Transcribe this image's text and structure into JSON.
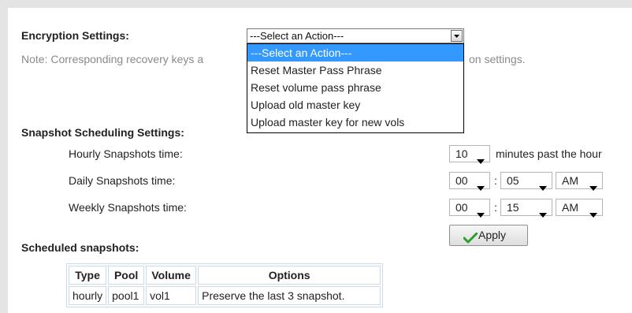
{
  "encryption": {
    "label": "Encryption Settings:",
    "selected": "---Select an Action---",
    "note_left": "Note: Corresponding recovery keys a",
    "note_right": "on settings.",
    "options": [
      "---Select an Action---",
      "Reset Master Pass Phrase",
      "Reset volume pass phrase",
      "Upload old master key",
      "Upload master key for new vols"
    ]
  },
  "snapshot": {
    "heading": "Snapshot Scheduling Settings:",
    "hourly": {
      "label": "Hourly Snapshots time:",
      "minute": "10",
      "suffix": "minutes past the hour"
    },
    "daily": {
      "label": "Daily Snapshots time:",
      "hour": "00",
      "sep": ":",
      "minute": "05",
      "ampm": "AM"
    },
    "weekly": {
      "label": "Weekly Snapshots time:",
      "hour": "00",
      "sep": ":",
      "minute": "15",
      "ampm": "AM"
    },
    "apply_label": "Apply"
  },
  "scheduled": {
    "heading": "Scheduled snapshots:",
    "columns": [
      "Type",
      "Pool",
      "Volume",
      "Options"
    ],
    "rows": [
      [
        "hourly",
        "pool1",
        "vol1",
        "Preserve the last 3 snapshot."
      ]
    ]
  },
  "colors": {
    "highlight": "#3399ff",
    "apply_check": "#2e9e2e"
  }
}
